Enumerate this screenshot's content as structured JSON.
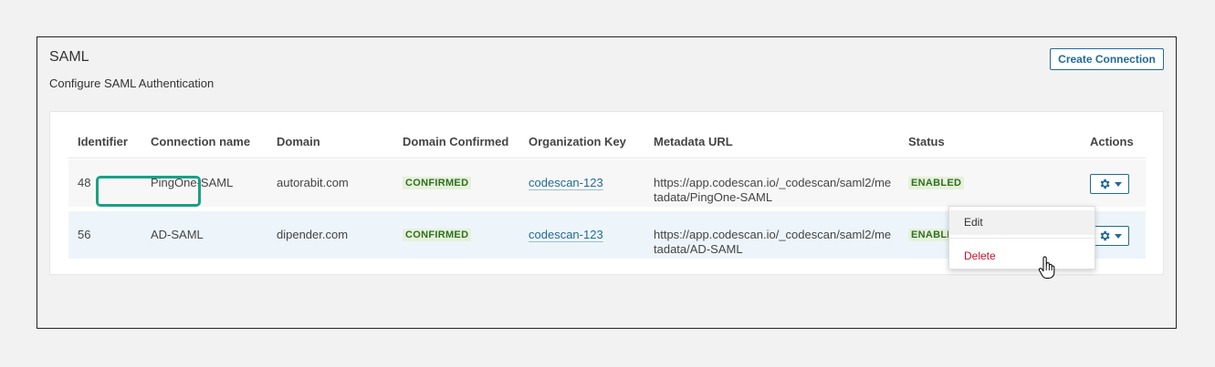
{
  "header": {
    "title": "SAML",
    "subtitle": "Configure SAML Authentication",
    "create_button": "Create Connection"
  },
  "table": {
    "columns": [
      "Identifier",
      "Connection name",
      "Domain",
      "Domain Confirmed",
      "Organization Key",
      "Metadata URL",
      "Status",
      "Actions"
    ],
    "rows": [
      {
        "identifier": "48",
        "name": "PingOne-SAML",
        "domain": "autorabit.com",
        "domain_confirmed": "CONFIRMED",
        "org_key": "codescan-123",
        "metadata_url": "https://app.codescan.io/_codescan/saml2/metadata/PingOne-SAML",
        "status": "ENABLED"
      },
      {
        "identifier": "56",
        "name": "AD-SAML",
        "domain": "dipender.com",
        "domain_confirmed": "CONFIRMED",
        "org_key": "codescan-123",
        "metadata_url": "https://app.codescan.io/_codescan/saml2/metadata/AD-SAML",
        "status": "ENABLED"
      }
    ]
  },
  "actions_menu": {
    "edit": "Edit",
    "delete": "Delete"
  },
  "icons": {
    "gear": "gear-icon",
    "caret": "chevron-down-icon",
    "cursor": "hand-pointer-icon"
  },
  "colors": {
    "accent": "#236a97",
    "confirmed_bg": "#e6f1dc",
    "confirmed_text": "#2f6f1f",
    "delete": "#c8102e",
    "highlight": "#1aa085"
  }
}
